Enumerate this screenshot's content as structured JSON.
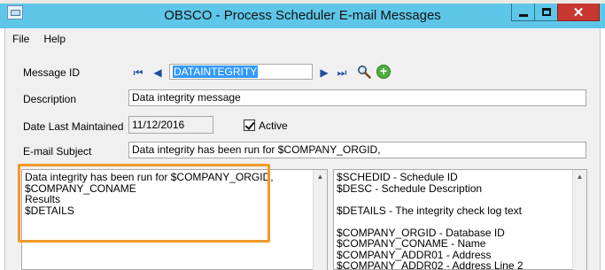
{
  "window": {
    "title": "OBSCO - Process Scheduler E-mail Messages",
    "min_label": "",
    "close_label": "✕"
  },
  "menu": [
    {
      "label": "File"
    },
    {
      "label": "Help"
    }
  ],
  "form": {
    "message_id_label": "Message ID",
    "message_id_value": "DATAINTEGRITY",
    "description_label": "Description",
    "description_value": "Data integrity message",
    "date_label": "Date Last Maintained",
    "date_value": "11/12/2016",
    "active_label": "Active",
    "active_checked": true,
    "subject_label": "E-mail Subject",
    "subject_value": "Data integrity has been run for $COMPANY_ORGID,"
  },
  "nav": {
    "first": "⏮",
    "prev": "◀",
    "next": "▶",
    "last": "⏭"
  },
  "body_text": "Data integrity has been run for $COMPANY_ORGID,\n$COMPANY_CONAME\nResults\n$DETAILS",
  "variables_text": "$SCHEDID - Schedule ID\n$DESC - Schedule Description\n\n$DETAILS - The integrity check log text\n\n$COMPANY_ORGID - Database ID\n$COMPANY_CONAME - Name\n$COMPANY_ADDR01 - Address\n$COMPANY_ADDR02 - Address Line 2",
  "colors": {
    "titlebar": "#5ec7e9",
    "close_button": "#c7372f",
    "highlight": "#f3982b",
    "selection": "#3399ff"
  },
  "icons": {
    "search": "magnifier-icon",
    "add": "green-plus-icon"
  }
}
